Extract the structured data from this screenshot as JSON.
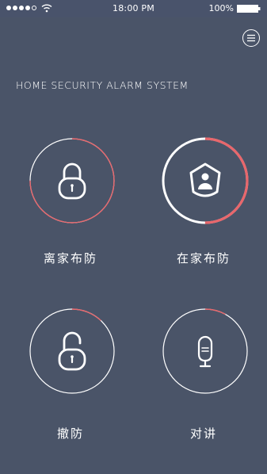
{
  "status_bar": {
    "time": "18:00 PM",
    "battery": "100%",
    "signal_bars": 4,
    "signal_max": 5
  },
  "header": {
    "menu_icon": "menu-icon",
    "title": "HOME SECURITY ALARM SYSTEM"
  },
  "controls": [
    {
      "label": "离家布防",
      "icon": "lock-icon",
      "progress": 0.75,
      "active": false
    },
    {
      "label": "在家布防",
      "icon": "home-shield-icon",
      "progress": 0.5,
      "active": true
    },
    {
      "label": "撤防",
      "icon": "unlock-icon",
      "progress": 0.12,
      "active": false
    },
    {
      "label": "对讲",
      "icon": "microphone-icon",
      "progress": 0.08,
      "active": false
    }
  ],
  "colors": {
    "background": "#4a5468",
    "accent": "#e8676c",
    "ring": "#ffffff"
  }
}
